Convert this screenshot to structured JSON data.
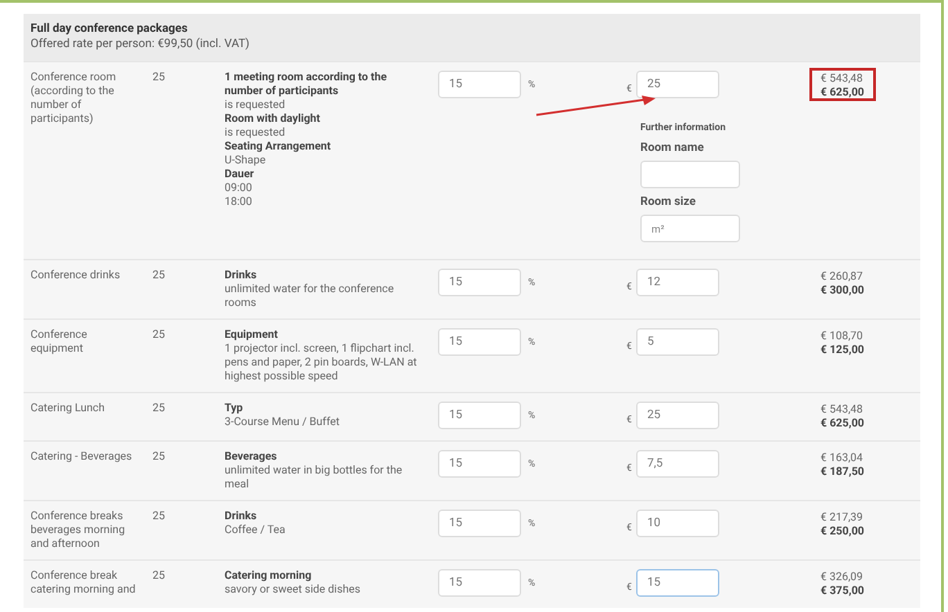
{
  "package": {
    "title": "Full day conference packages",
    "subtitle": "Offered rate per person: €99,50 (incl. VAT)"
  },
  "rows": [
    {
      "name": "Conference room (according to the number of participants)",
      "quantity": "25",
      "details": [
        {
          "title": "1 meeting room according to the number of participants",
          "lines": [
            "is requested"
          ]
        },
        {
          "title": "Room with daylight",
          "lines": [
            "is requested"
          ]
        },
        {
          "title": "Seating Arrangement",
          "lines": [
            "U-Shape"
          ]
        },
        {
          "title": "Dauer",
          "lines": [
            "09:00",
            "18:00"
          ]
        }
      ],
      "percent": "15",
      "percent_unit": "%",
      "currency": "€",
      "price": "25",
      "focused": false,
      "annotated": true,
      "further_info": {
        "heading": "Further information",
        "fields": [
          {
            "label": "Room name"
          },
          {
            "label": "Room size",
            "placeholder": "m²"
          }
        ]
      },
      "net": "€ 543,48",
      "gross": "€ 625,00",
      "highlighted": true
    },
    {
      "name": "Conference drinks",
      "quantity": "25",
      "details": [
        {
          "title": "Drinks",
          "lines": [
            "unlimited water for the conference rooms"
          ]
        }
      ],
      "percent": "15",
      "percent_unit": "%",
      "currency": "€",
      "price": "12",
      "focused": false,
      "annotated": false,
      "net": "€ 260,87",
      "gross": "€ 300,00",
      "highlighted": false
    },
    {
      "name": "Conference equipment",
      "quantity": "25",
      "details": [
        {
          "title": "Equipment",
          "lines": [
            "1 projector incl. screen, 1 flipchart incl. pens and paper, 2 pin boards, W-LAN at highest possible speed"
          ]
        }
      ],
      "percent": "15",
      "percent_unit": "%",
      "currency": "€",
      "price": "5",
      "focused": false,
      "annotated": false,
      "net": "€ 108,70",
      "gross": "€ 125,00",
      "highlighted": false
    },
    {
      "name": "Catering Lunch",
      "quantity": "25",
      "details": [
        {
          "title": "Typ",
          "lines": [
            "3-Course Menu / Buffet"
          ]
        }
      ],
      "percent": "15",
      "percent_unit": "%",
      "currency": "€",
      "price": "25",
      "focused": false,
      "annotated": false,
      "net": "€ 543,48",
      "gross": "€ 625,00",
      "highlighted": false
    },
    {
      "name": "Catering - Beverages",
      "quantity": "25",
      "details": [
        {
          "title": "Beverages",
          "lines": [
            "unlimited water in big bottles for the meal"
          ]
        }
      ],
      "percent": "15",
      "percent_unit": "%",
      "currency": "€",
      "price": "7,5",
      "focused": false,
      "annotated": false,
      "net": "€ 163,04",
      "gross": "€ 187,50",
      "highlighted": false
    },
    {
      "name": "Conference breaks beverages morning and afternoon",
      "quantity": "25",
      "details": [
        {
          "title": "Drinks",
          "lines": [
            "Coffee / Tea"
          ]
        }
      ],
      "percent": "15",
      "percent_unit": "%",
      "currency": "€",
      "price": "10",
      "focused": false,
      "annotated": false,
      "net": "€ 217,39",
      "gross": "€ 250,00",
      "highlighted": false
    },
    {
      "name": "Conference break catering morning and",
      "quantity": "25",
      "details": [
        {
          "title": "Catering morning",
          "lines": [
            "savory or sweet side dishes"
          ]
        }
      ],
      "percent": "15",
      "percent_unit": "%",
      "currency": "€",
      "price": "15",
      "focused": true,
      "annotated": false,
      "net": "€ 326,09",
      "gross": "€ 375,00",
      "highlighted": false
    }
  ]
}
